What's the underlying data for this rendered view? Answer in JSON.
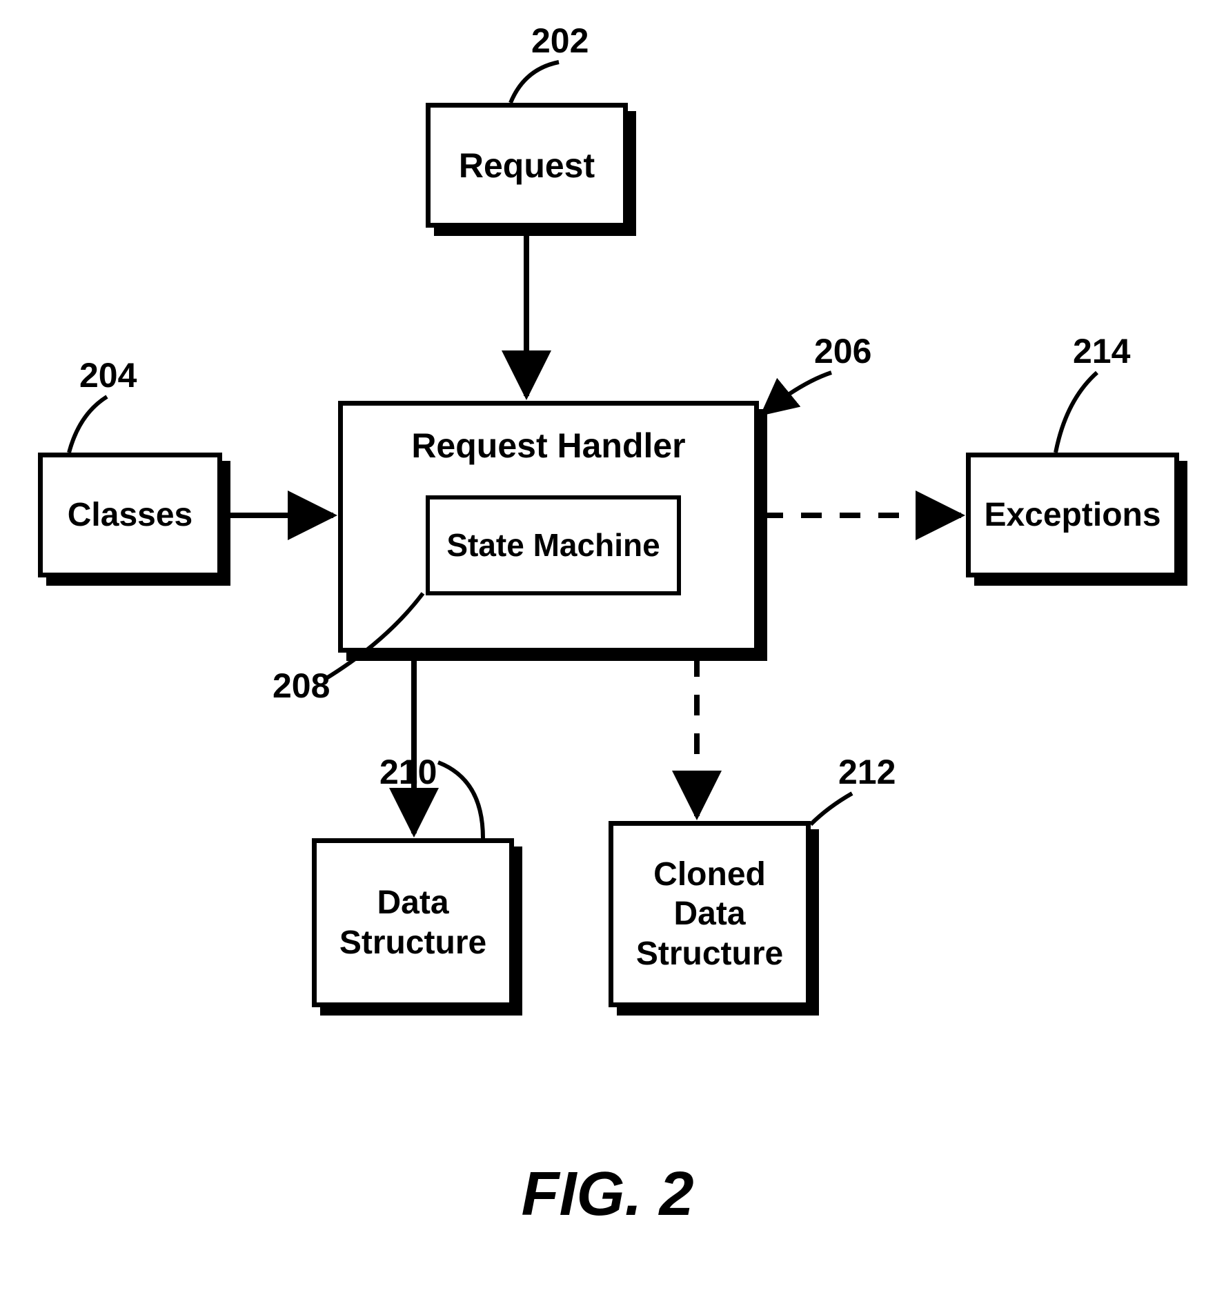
{
  "figure_label": "FIG. 2",
  "boxes": {
    "request": {
      "label": "Request",
      "ref": "202"
    },
    "classes": {
      "label": "Classes",
      "ref": "204"
    },
    "handler": {
      "label": "Request Handler",
      "ref": "206"
    },
    "state_machine": {
      "label": "State Machine",
      "ref": "208"
    },
    "data_structure": {
      "label": "Data\nStructure",
      "ref": "210"
    },
    "cloned": {
      "label": "Cloned\nData\nStructure",
      "ref": "212"
    },
    "exceptions": {
      "label": "Exceptions",
      "ref": "214"
    }
  },
  "chart_data": {
    "type": "diagram",
    "nodes": [
      {
        "id": "request",
        "label": "Request",
        "ref": "202"
      },
      {
        "id": "classes",
        "label": "Classes",
        "ref": "204"
      },
      {
        "id": "handler",
        "label": "Request Handler",
        "ref": "206"
      },
      {
        "id": "state_machine",
        "label": "State Machine",
        "ref": "208",
        "parent": "handler"
      },
      {
        "id": "data_structure",
        "label": "Data Structure",
        "ref": "210"
      },
      {
        "id": "cloned",
        "label": "Cloned Data Structure",
        "ref": "212"
      },
      {
        "id": "exceptions",
        "label": "Exceptions",
        "ref": "214"
      }
    ],
    "edges": [
      {
        "from": "request",
        "to": "handler",
        "style": "solid"
      },
      {
        "from": "classes",
        "to": "handler",
        "style": "solid"
      },
      {
        "from": "handler",
        "to": "data_structure",
        "style": "solid"
      },
      {
        "from": "handler",
        "to": "cloned",
        "style": "dashed"
      },
      {
        "from": "handler",
        "to": "exceptions",
        "style": "dashed"
      }
    ],
    "leaders": [
      {
        "ref": "202",
        "to": "request"
      },
      {
        "ref": "204",
        "to": "classes"
      },
      {
        "ref": "206",
        "to": "handler"
      },
      {
        "ref": "208",
        "to": "state_machine"
      },
      {
        "ref": "210",
        "to": "data_structure"
      },
      {
        "ref": "212",
        "to": "cloned"
      },
      {
        "ref": "214",
        "to": "exceptions"
      }
    ]
  }
}
